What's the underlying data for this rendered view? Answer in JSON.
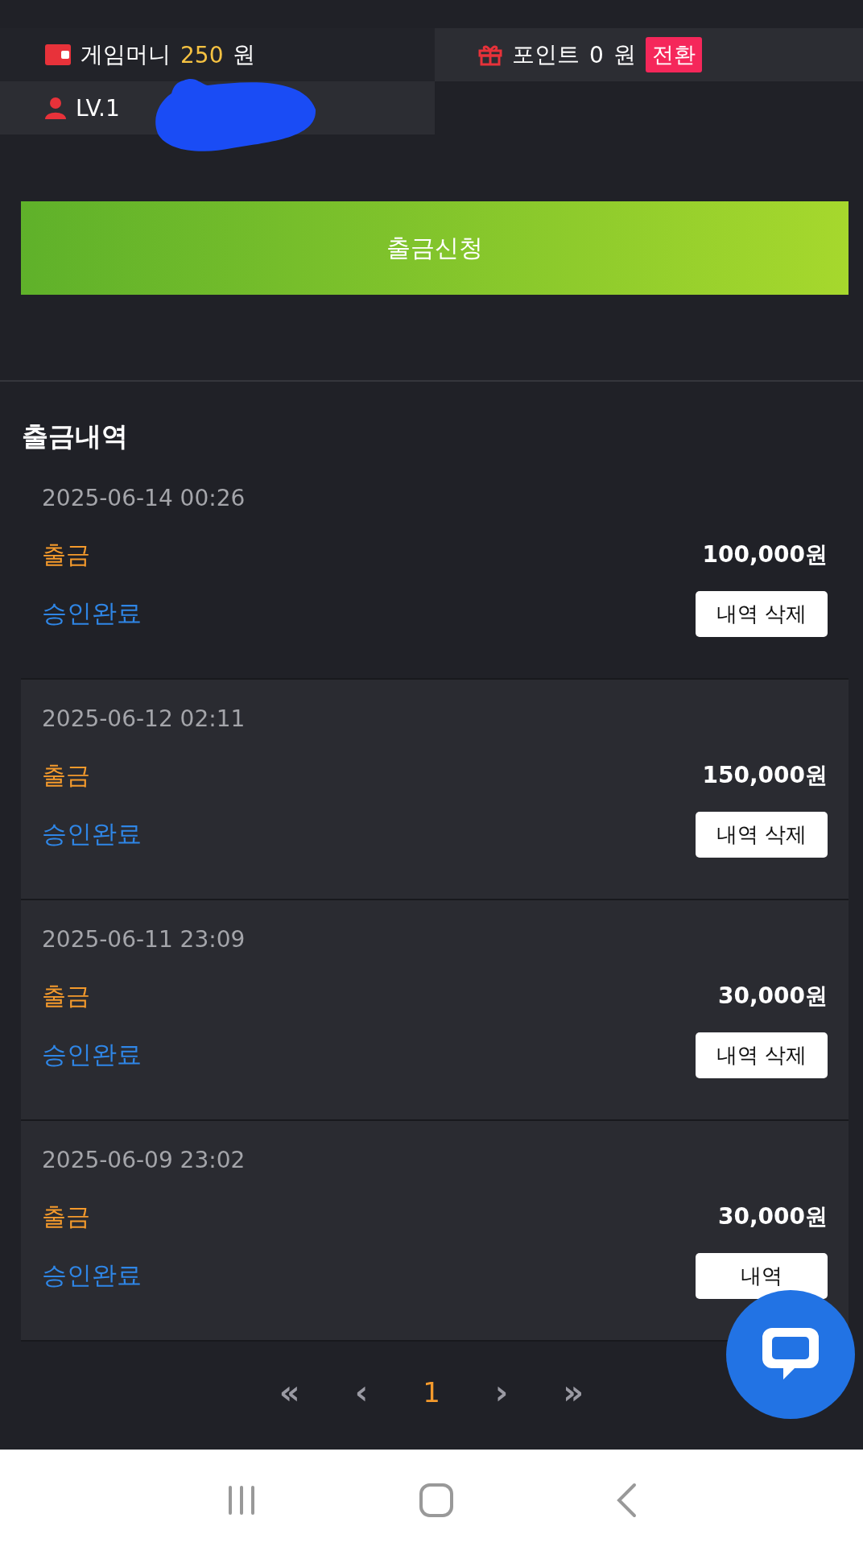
{
  "wallet": {
    "money_label": "게임머니",
    "money_value": "250",
    "money_unit": "원",
    "point_label": "포인트",
    "point_value": "0",
    "point_unit": "원",
    "convert_button": "전환",
    "level": "LV.1"
  },
  "withdraw_button": "출금신청",
  "history": {
    "title": "출금내역",
    "items": [
      {
        "date": "2025-06-14 00:26",
        "type": "출금",
        "amount": "100,000원",
        "status": "승인완료",
        "delete_button": "내역 삭제"
      },
      {
        "date": "2025-06-12 02:11",
        "type": "출금",
        "amount": "150,000원",
        "status": "승인완료",
        "delete_button": "내역 삭제"
      },
      {
        "date": "2025-06-11 23:09",
        "type": "출금",
        "amount": "30,000원",
        "status": "승인완료",
        "delete_button": "내역 삭제"
      },
      {
        "date": "2025-06-09 23:02",
        "type": "출금",
        "amount": "30,000원",
        "status": "승인완료",
        "delete_button": "내역"
      }
    ]
  },
  "pagination": {
    "first": "«",
    "prev": "‹",
    "pages": [
      {
        "label": "1",
        "selected": true
      }
    ],
    "next": "›",
    "last": "»"
  }
}
